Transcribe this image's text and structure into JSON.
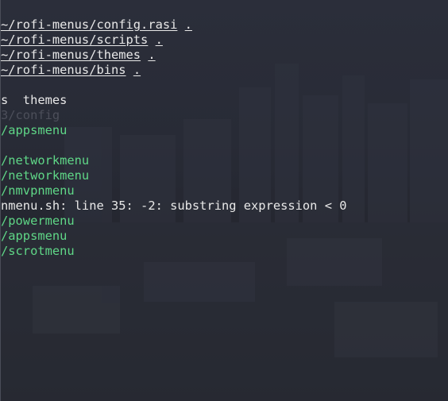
{
  "lines": [
    {
      "text": "~/rofi-menus/config.rasi",
      "suffix": " .",
      "color": "#e8e8e8",
      "underline": true
    },
    {
      "text": "~/rofi-menus/scripts",
      "suffix": " .",
      "color": "#e8e8e8",
      "underline": true
    },
    {
      "text": "~/rofi-menus/themes",
      "suffix": " .",
      "color": "#e8e8e8",
      "underline": true
    },
    {
      "text": "~/rofi-menus/bins",
      "suffix": " .",
      "color": "#e8e8e8",
      "underline": true
    },
    {
      "text": "",
      "suffix": "",
      "color": "#e8e8e8",
      "underline": false
    },
    {
      "text": "s  themes",
      "suffix": "",
      "color": "#e8e8e8",
      "underline": false
    },
    {
      "text": "3/config",
      "suffix": "",
      "color": "#4c4f5a",
      "underline": false
    },
    {
      "text": "/appsmenu",
      "suffix": "",
      "color": "#5fd787",
      "underline": false
    },
    {
      "text": "",
      "suffix": "",
      "color": "#e8e8e8",
      "underline": false
    },
    {
      "text": "/networkmenu",
      "suffix": "",
      "color": "#5fd787",
      "underline": false
    },
    {
      "text": "/networkmenu",
      "suffix": "",
      "color": "#5fd787",
      "underline": false
    },
    {
      "text": "/nmvpnmenu",
      "suffix": "",
      "color": "#5fd787",
      "underline": false
    },
    {
      "text": "nmenu.sh: line 35: -2: substring expression < 0",
      "suffix": "",
      "color": "#e8e8e8",
      "underline": false
    },
    {
      "text": "/powermenu",
      "suffix": "",
      "color": "#5fd787",
      "underline": false
    },
    {
      "text": "/appsmenu",
      "suffix": "",
      "color": "#5fd787",
      "underline": false
    },
    {
      "text": "/scrotmenu",
      "suffix": "",
      "color": "#5fd787",
      "underline": false
    }
  ],
  "colors": {
    "background": "#282b36",
    "foreground": "#e8e8e8",
    "green": "#5fd787",
    "dim": "#4c4f5a"
  }
}
